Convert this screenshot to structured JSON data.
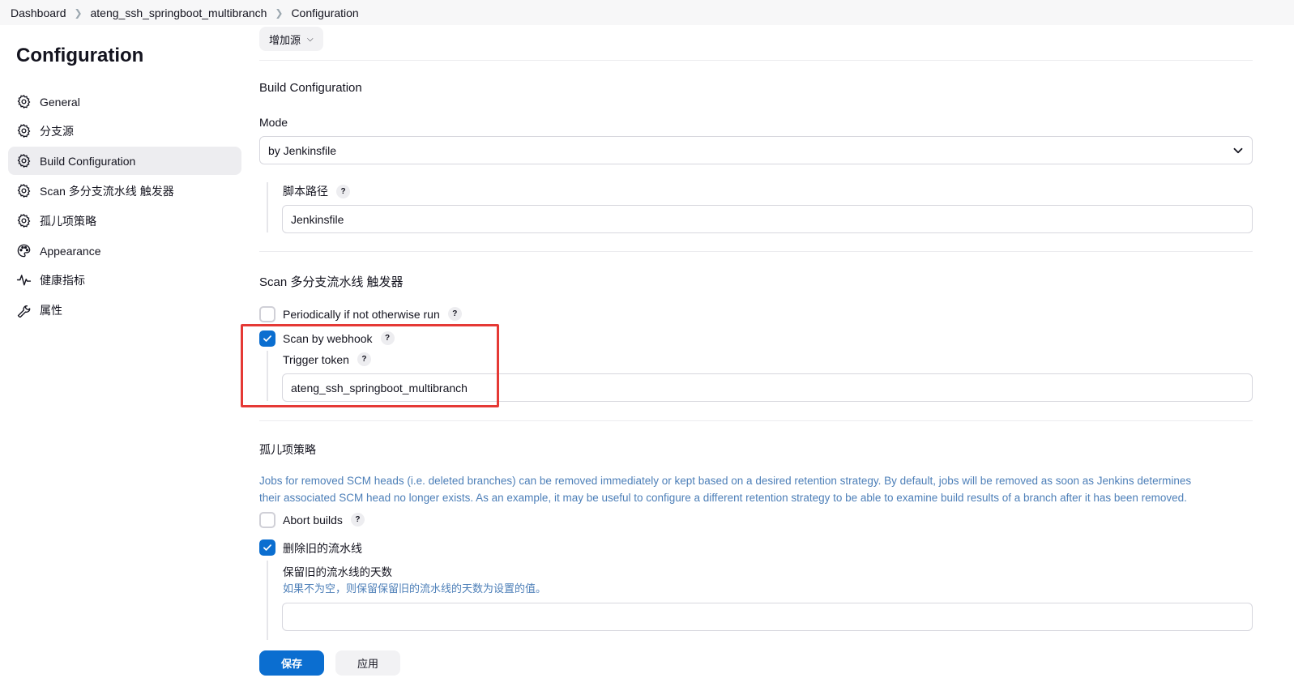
{
  "breadcrumb": {
    "items": [
      "Dashboard",
      "ateng_ssh_springboot_multibranch",
      "Configuration"
    ]
  },
  "sidebar": {
    "title": "Configuration",
    "items": [
      {
        "label": "General",
        "icon": "gear-icon"
      },
      {
        "label": "分支源",
        "icon": "gear-icon"
      },
      {
        "label": "Build Configuration",
        "icon": "gear-icon",
        "active": true
      },
      {
        "label": "Scan 多分支流水线 触发器",
        "icon": "gear-icon"
      },
      {
        "label": "孤儿项策略",
        "icon": "gear-icon"
      },
      {
        "label": "Appearance",
        "icon": "palette-icon"
      },
      {
        "label": "健康指标",
        "icon": "pulse-icon"
      },
      {
        "label": "属性",
        "icon": "wrench-icon"
      }
    ]
  },
  "main": {
    "add_source_label": "增加源",
    "build_config": {
      "title": "Build Configuration",
      "mode_label": "Mode",
      "mode_value": "by Jenkinsfile",
      "script_path_label": "脚本路径",
      "script_path_value": "Jenkinsfile"
    },
    "scan_triggers": {
      "title": "Scan 多分支流水线 触发器",
      "periodic_label": "Periodically if not otherwise run",
      "periodic_checked": false,
      "webhook_label": "Scan by webhook",
      "webhook_checked": true,
      "trigger_token_label": "Trigger token",
      "trigger_token_value": "ateng_ssh_springboot_multibranch"
    },
    "orphan": {
      "title": "孤儿项策略",
      "description": "Jobs for removed SCM heads (i.e. deleted branches) can be removed immediately or kept based on a desired retention strategy. By default, jobs will be removed as soon as Jenkins determines their associated SCM head no longer exists. As an example, it may be useful to configure a different retention strategy to be able to examine build results of a branch after it has been removed.",
      "abort_builds_label": "Abort builds",
      "abort_builds_checked": false,
      "delete_old_label": "删除旧的流水线",
      "delete_old_checked": true,
      "days_label": "保留旧的流水线的天数",
      "days_hint": "如果不为空，则保留保留旧的流水线的天数为设置的值。",
      "days_value": ""
    }
  },
  "actions": {
    "save_label": "保存",
    "apply_label": "应用"
  },
  "colors": {
    "primary": "#0b6ed0",
    "highlight_border": "#e53935",
    "description": "#4d7fb8"
  }
}
